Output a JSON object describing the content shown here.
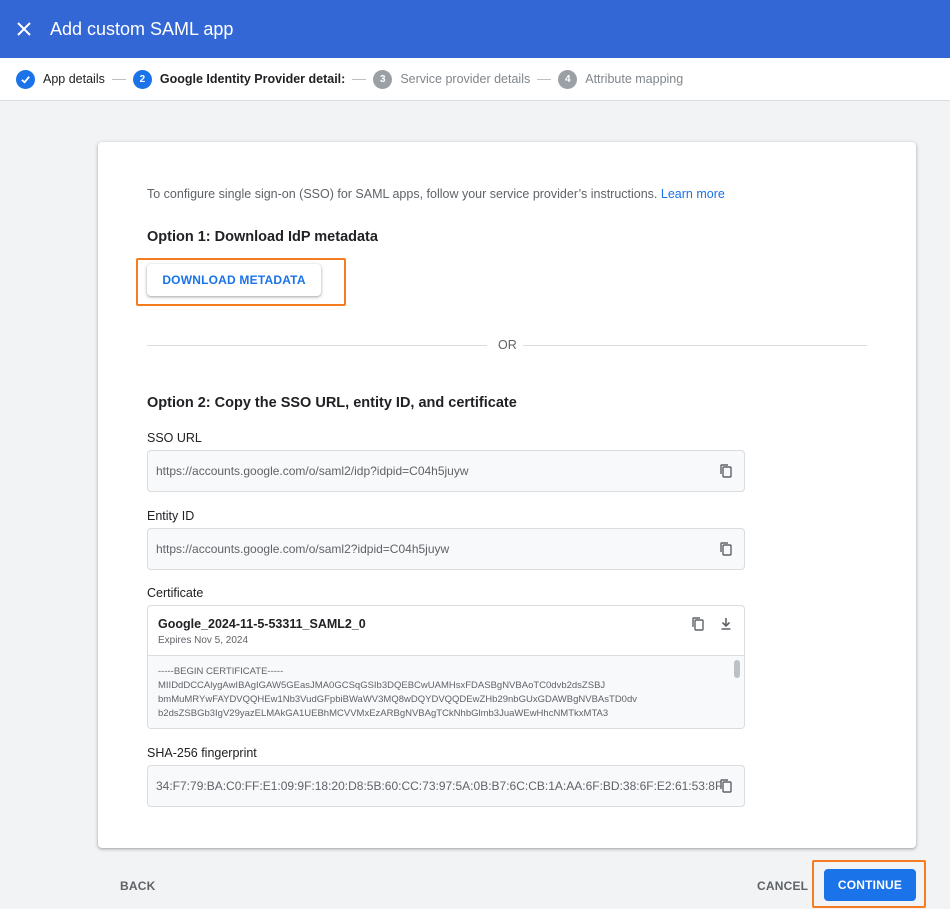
{
  "header": {
    "title": "Add custom SAML app",
    "close_icon": "close-icon",
    "bg_color": "#3367d6"
  },
  "stepper": {
    "steps": [
      {
        "label": "App details",
        "state": "done",
        "icon": "check-circle-icon"
      },
      {
        "number": "2",
        "label": "Google Identity Provider detail:",
        "state": "active"
      },
      {
        "number": "3",
        "label": "Service provider details",
        "state": "inactive"
      },
      {
        "number": "4",
        "label": "Attribute mapping",
        "state": "inactive"
      }
    ]
  },
  "main": {
    "intro_text": "To configure single sign-on (SSO) for SAML apps, follow your service provider’s instructions.",
    "learn_more": "Learn more",
    "option1_title": "Option 1: Download IdP metadata",
    "download_button": "DOWNLOAD METADATA",
    "or_text": "OR",
    "option2_title": "Option 2: Copy the SSO URL, entity ID, and certificate",
    "sso_url": {
      "label": "SSO URL",
      "value": "https://accounts.google.com/o/saml2/idp?idpid=C04h5juyw",
      "icon": "copy-icon"
    },
    "entity_id": {
      "label": "Entity ID",
      "value": "https://accounts.google.com/o/saml2?idpid=C04h5juyw",
      "icon": "copy-icon"
    },
    "certificate": {
      "label": "Certificate",
      "name": "Google_2024-11-5-53311_SAML2_0",
      "expires": "Expires Nov 5, 2024",
      "lines": [
        "-----BEGIN CERTIFICATE-----",
        "MIIDdDCCAlygAwIBAgIGAW5GEasJMA0GCSqGSIb3DQEBCwUAMHsxFDASBgNVBAoTC0dvb2dsZSBJ",
        "bmMuMRYwFAYDVQQHEw1Nb3VudGFpbiBWaWV3MQ8wDQYDVQQDEwZHb29nbGUxGDAWBgNVBAsTD0dv",
        "b2dsZSBGb3IgV29yazELMAkGA1UEBhMCVVMxEzARBgNVBAgTCkNhbGlmb3JuaWEwHhcNMTkxMTA3"
      ],
      "icons": [
        "copy-icon",
        "download-icon"
      ]
    },
    "fingerprint": {
      "label": "SHA-256 fingerprint",
      "value": "34:F7:79:BA:C0:FF:E1:09:9F:18:20:D8:5B:60:CC:73:97:5A:0B:B7:6C:CB:1A:AA:6F:BD:38:6F:E2:61:53:8F",
      "icon": "copy-icon"
    }
  },
  "footer": {
    "back": "BACK",
    "cancel": "CANCEL",
    "continue": "CONTINUE"
  },
  "colors": {
    "accent": "#1a73e8",
    "highlight": "#f57c1f"
  }
}
